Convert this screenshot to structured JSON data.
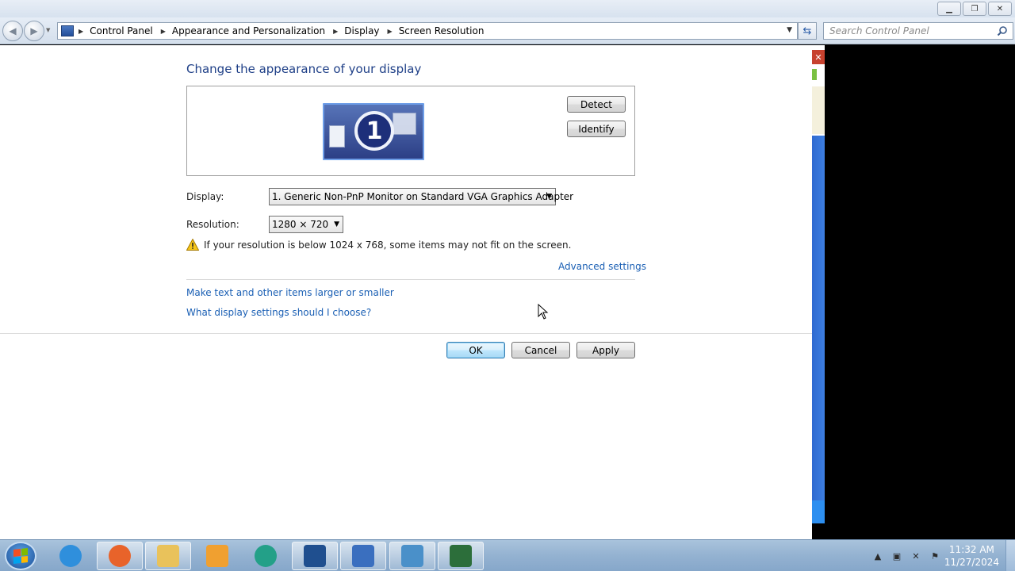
{
  "window": {
    "controls": [
      "minimize",
      "restore",
      "close"
    ]
  },
  "address": {
    "breadcrumbs": [
      "Control Panel",
      "Appearance and Personalization",
      "Display",
      "Screen Resolution"
    ],
    "search_placeholder": "Search Control Panel"
  },
  "page": {
    "title": "Change the appearance of your display",
    "monitor_number": "1",
    "detect_label": "Detect",
    "identify_label": "Identify",
    "display_label": "Display:",
    "display_value": "1. Generic Non-PnP Monitor on Standard VGA Graphics Adapter",
    "resolution_label": "Resolution:",
    "resolution_value": "1280 × 720",
    "warning_text": "If your resolution is below 1024 x 768, some items may not fit on the screen.",
    "advanced_link": "Advanced settings",
    "larger_link": "Make text and other items larger or smaller",
    "which_link": "What display settings should I choose?",
    "ok_label": "OK",
    "cancel_label": "Cancel",
    "apply_label": "Apply"
  },
  "taskbar": {
    "items": [
      {
        "name": "internet-explorer-icon",
        "color": "#2f8fdc",
        "open": false
      },
      {
        "name": "firefox-icon",
        "color": "#e8632a",
        "open": true
      },
      {
        "name": "file-explorer-icon",
        "color": "#e9c25b",
        "open": true
      },
      {
        "name": "media-player-icon",
        "color": "#f0a030",
        "open": false
      },
      {
        "name": "teal-app-icon",
        "color": "#23a088",
        "open": false
      },
      {
        "name": "virtualbox-icon",
        "color": "#1f4f8f",
        "open": true
      },
      {
        "name": "xp-mode-icon",
        "color": "#3a6fbf",
        "open": true
      },
      {
        "name": "network-app-icon",
        "color": "#4a90c9",
        "open": true
      },
      {
        "name": "terminal-monitor-icon",
        "color": "#2c6e3a",
        "open": true
      }
    ],
    "time": "11:32 AM",
    "date": "11/27/2024"
  }
}
